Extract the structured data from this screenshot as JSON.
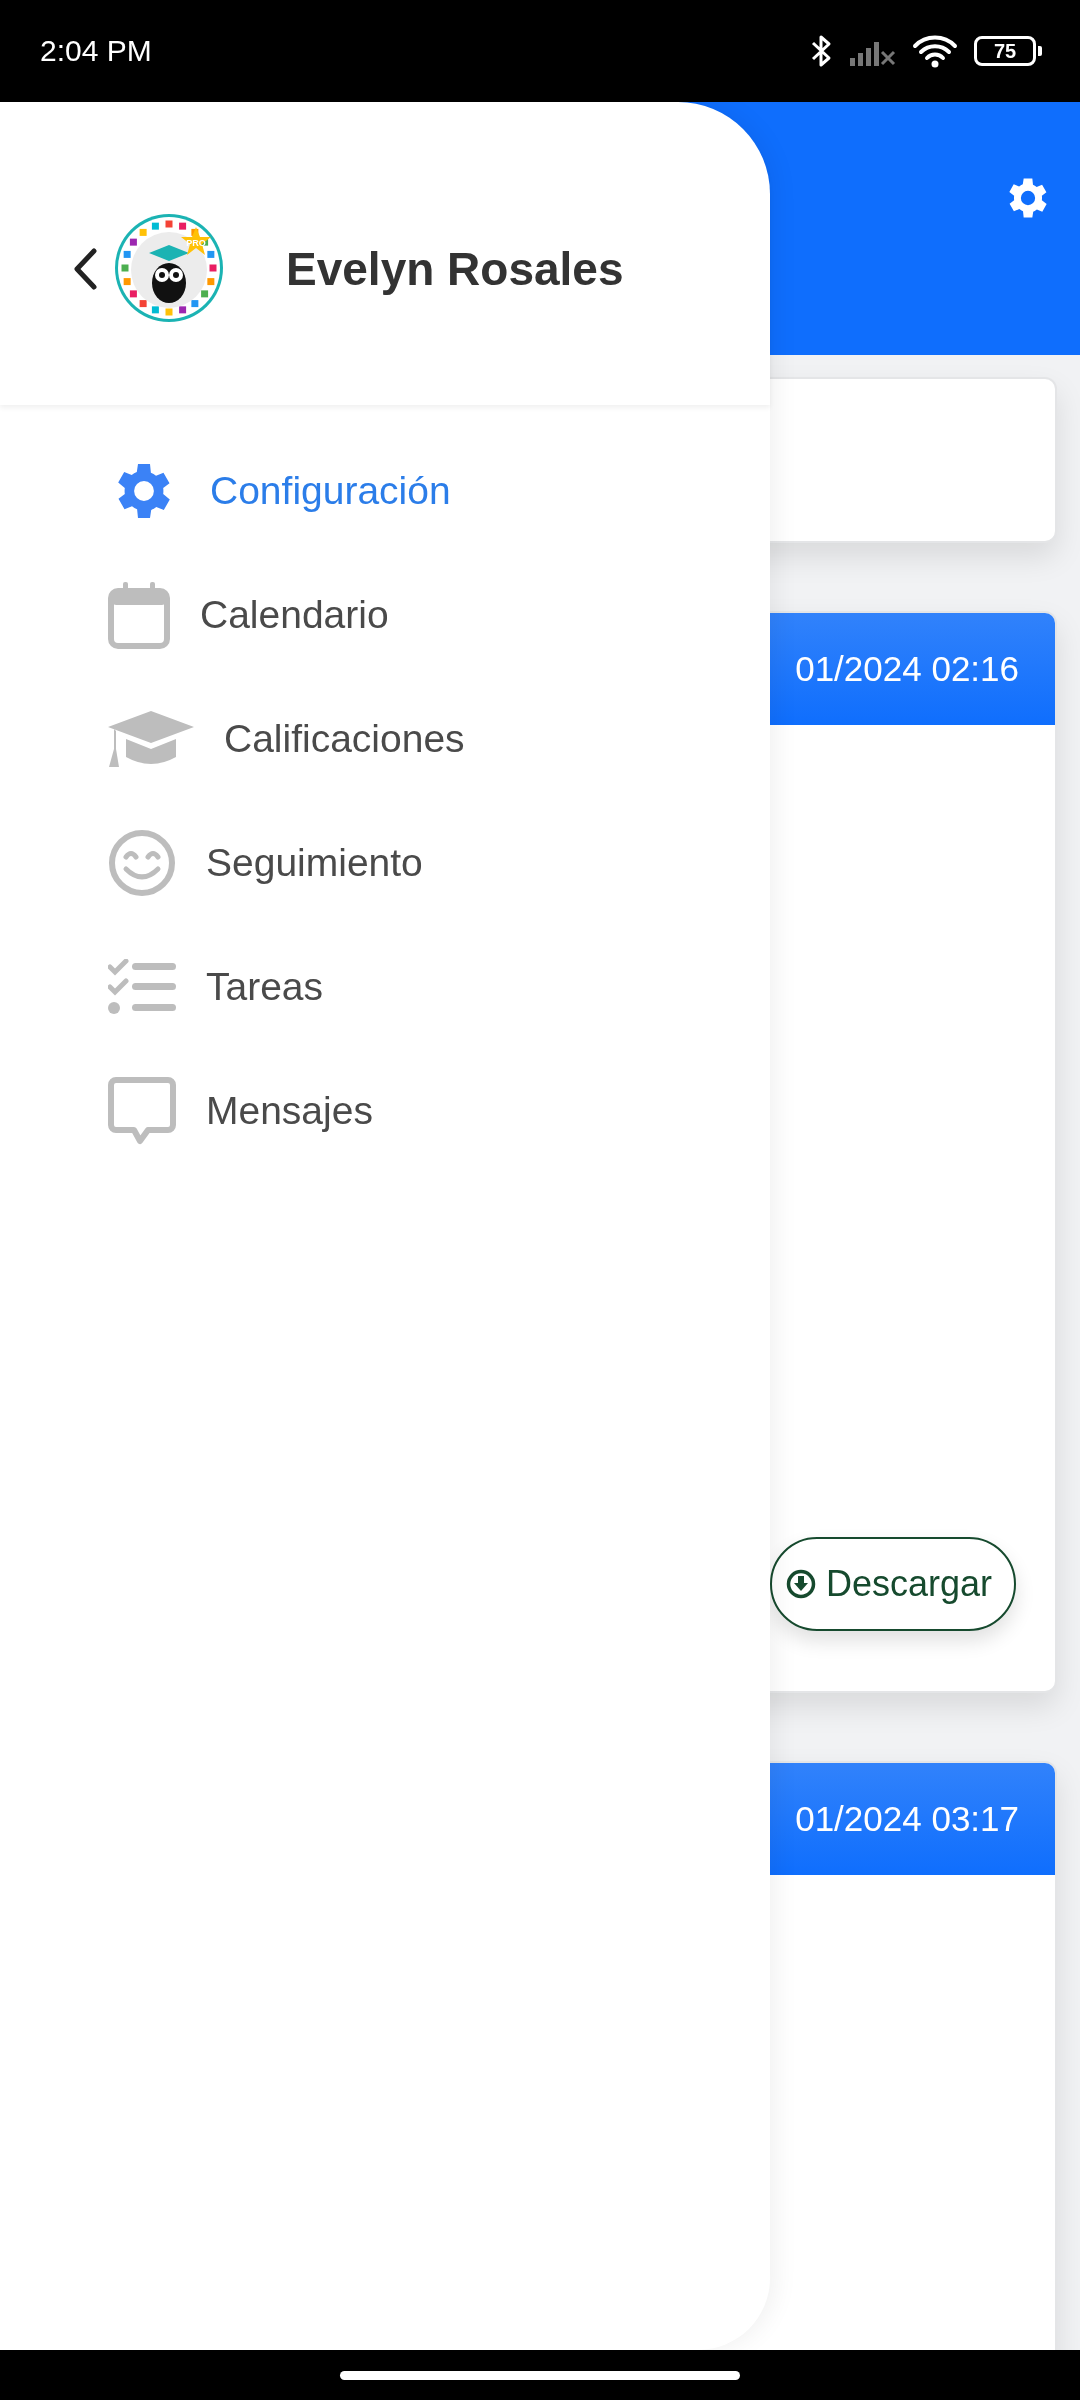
{
  "status_bar": {
    "time": "2:04 PM",
    "battery": "75"
  },
  "drawer": {
    "user_name": "Evelyn Rosales",
    "logo_badge": "PRO",
    "items": [
      {
        "label": "Configuración",
        "selected": true
      },
      {
        "label": "Calendario",
        "selected": false
      },
      {
        "label": "Calificaciones",
        "selected": false
      },
      {
        "label": "Seguimiento",
        "selected": false
      },
      {
        "label": "Tareas",
        "selected": false
      },
      {
        "label": "Mensajes",
        "selected": false
      }
    ]
  },
  "background": {
    "cards": [
      {
        "kind": "plain"
      },
      {
        "kind": "entry",
        "header": "01/2024 02:16",
        "button": "Descargar"
      },
      {
        "kind": "entry",
        "header": "01/2024 03:17"
      }
    ]
  }
}
